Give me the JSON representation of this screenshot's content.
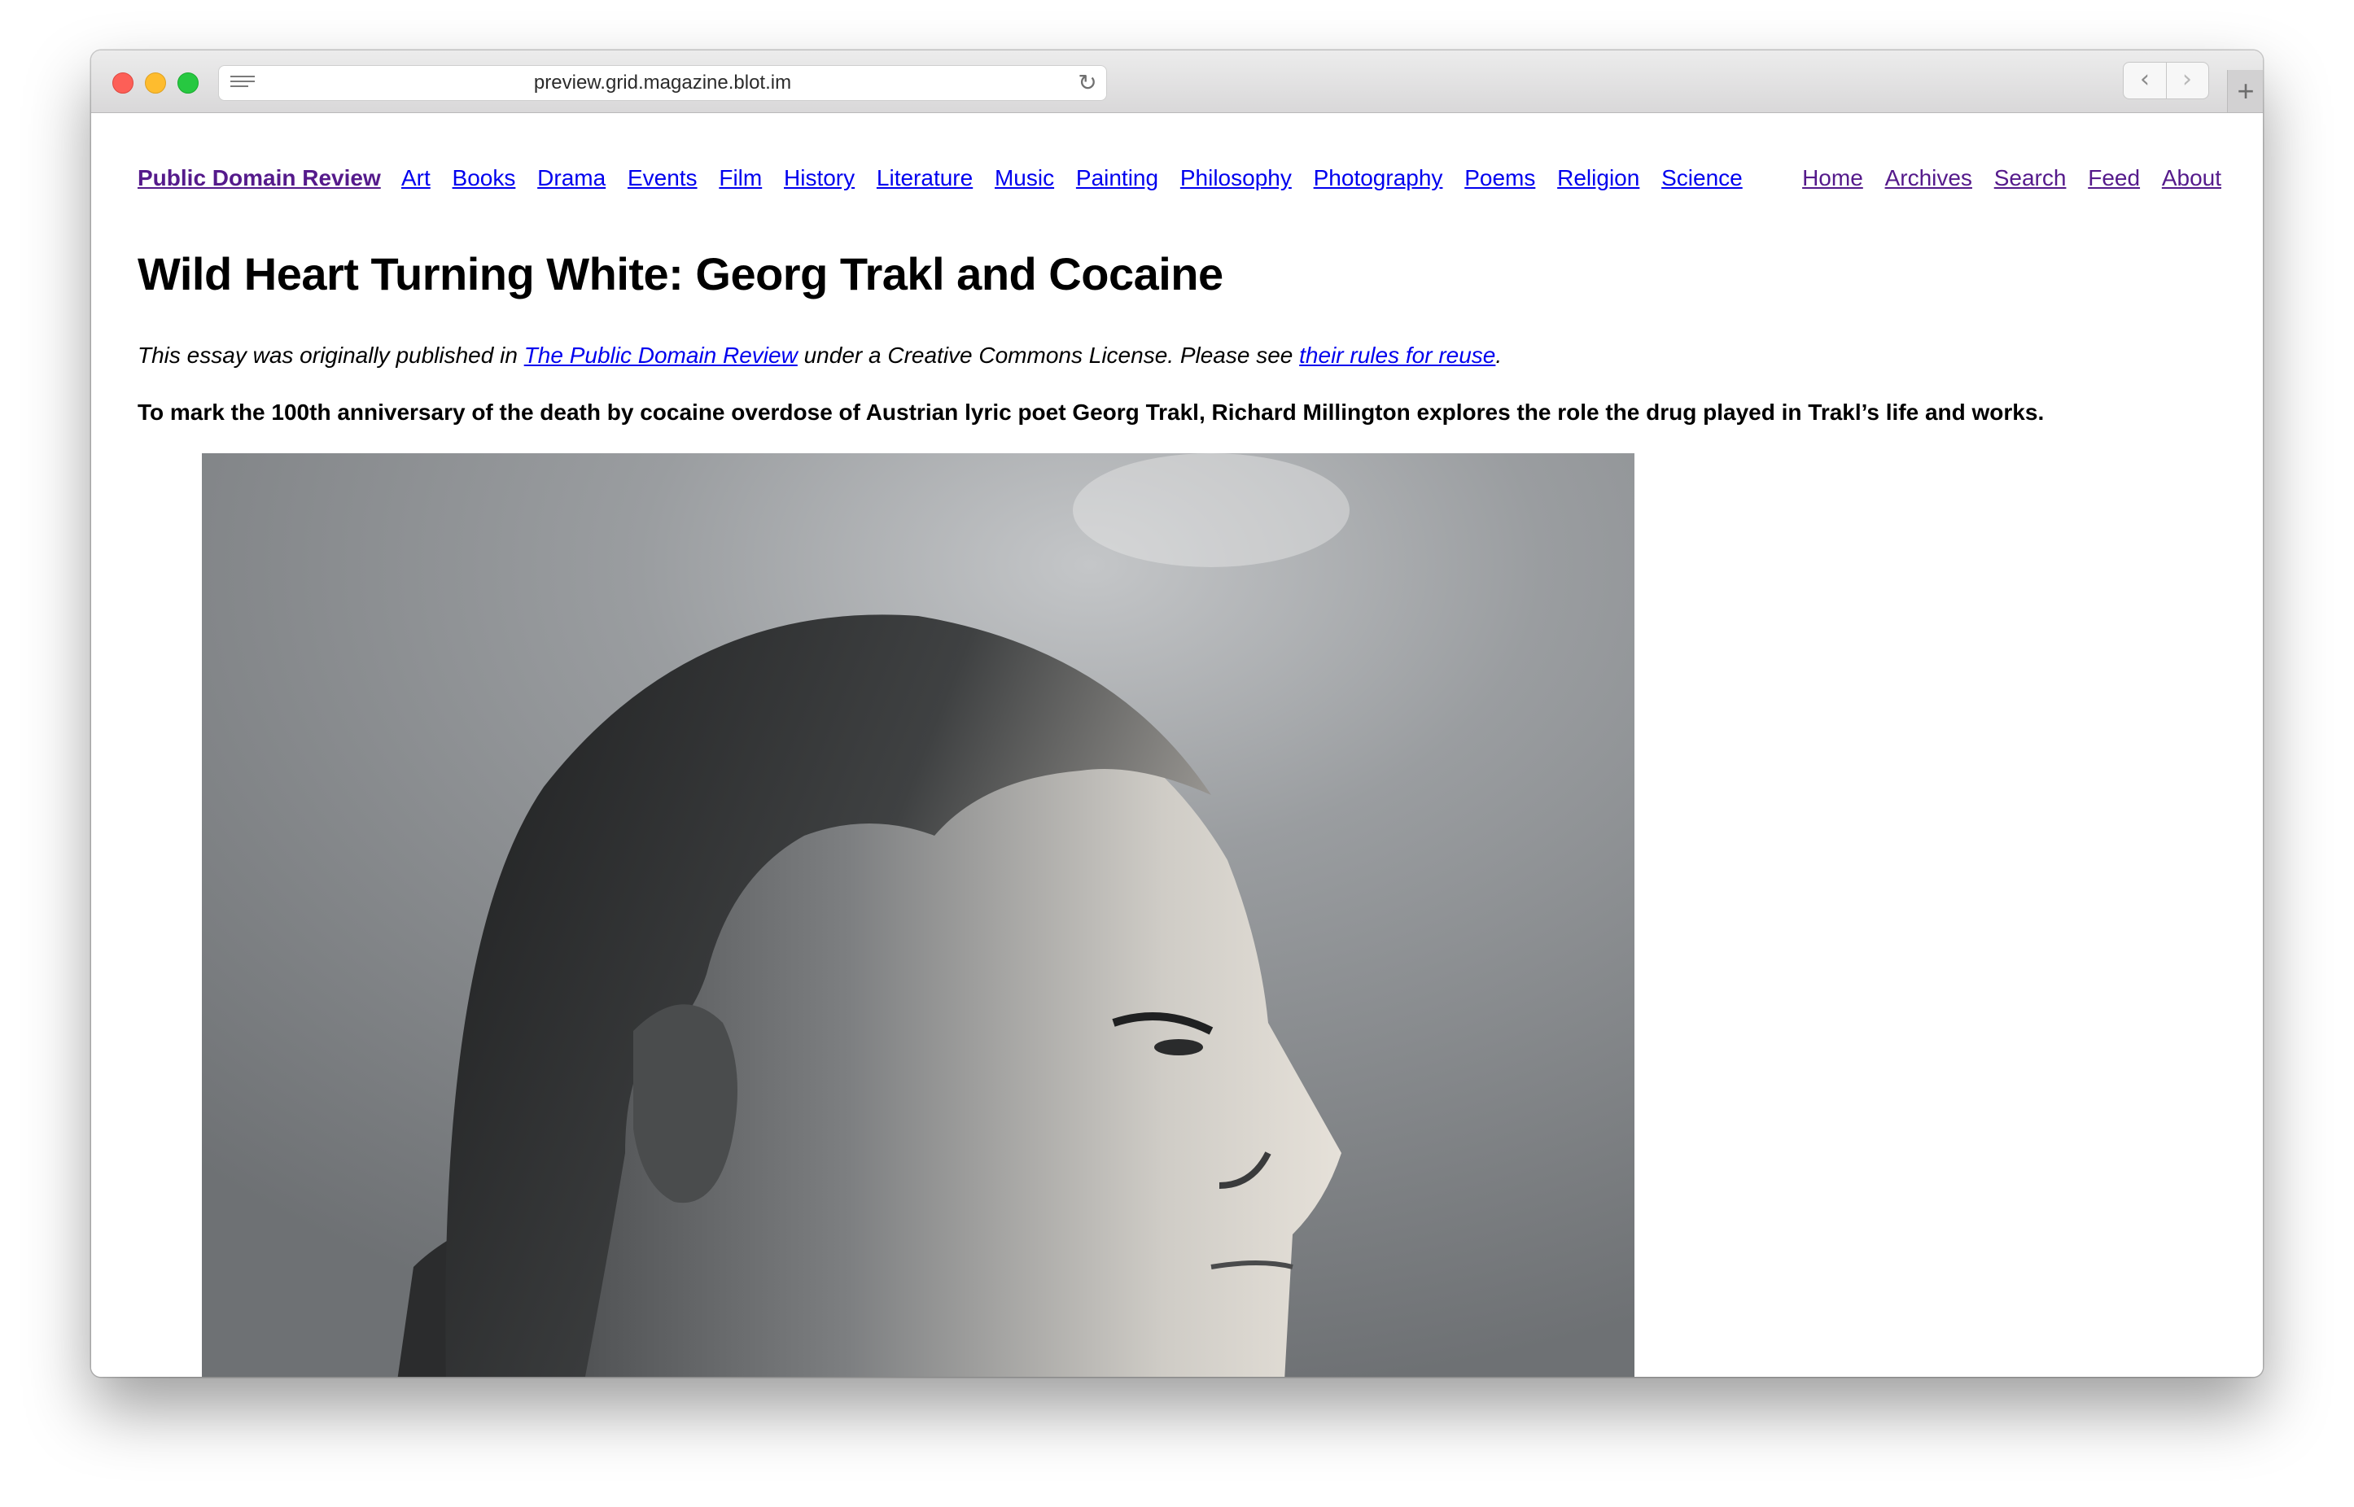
{
  "browser": {
    "url": "preview.grid.magazine.blot.im",
    "reload_icon": "reload-icon",
    "back_icon": "chevron-left-icon",
    "forward_icon": "chevron-right-icon",
    "new_tab_icon": "plus-icon",
    "glyphs": {
      "reload": "↻",
      "back": "‹",
      "forward": "›",
      "new_tab": "+"
    }
  },
  "nav": {
    "brand": "Public Domain Review",
    "categories": [
      "Art",
      "Books",
      "Drama",
      "Events",
      "Film",
      "History",
      "Literature",
      "Music",
      "Painting",
      "Philosophy",
      "Photography",
      "Poems",
      "Religion",
      "Science"
    ],
    "pages": [
      "Home",
      "Archives",
      "Search",
      "Feed",
      "About"
    ]
  },
  "article": {
    "title": "Wild Heart Turning White: Georg Trakl and Cocaine",
    "notice_prefix": "This essay was originally published in ",
    "notice_link": "The Public Domain Review",
    "notice_middle": " under a Creative Commons License. Please see ",
    "notice_link2": "their rules for reuse",
    "notice_suffix": ".",
    "lede": "To mark the 100th anniversary of the death by cocaine overdose of Austrian lyric poet Georg Trakl, Richard Millington explores the role the drug played in Trakl’s life and works."
  },
  "colors": {
    "link": "#0000ee",
    "visited_link": "#551a8b",
    "text": "#000000",
    "traffic_red": "#fd5f57",
    "traffic_yellow": "#febc2e",
    "traffic_green": "#27c841"
  }
}
